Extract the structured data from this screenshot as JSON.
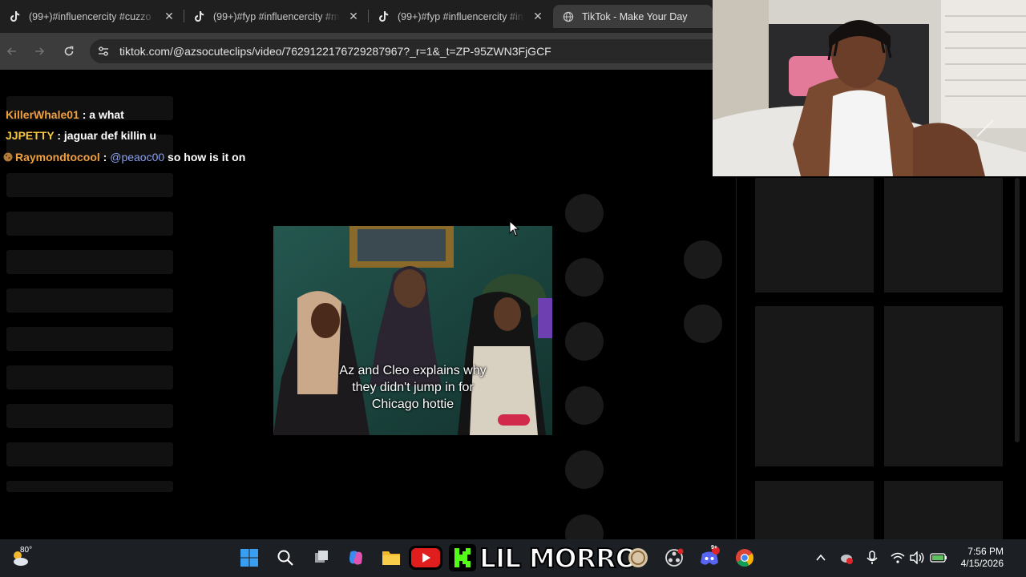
{
  "browser": {
    "tabs": [
      {
        "title": "(99+)#influencercity #cuzzo",
        "active": false
      },
      {
        "title": "(99+)#fyp #influencercity #m",
        "active": false
      },
      {
        "title": "(99+)#fyp #influencercity #inf",
        "active": false
      },
      {
        "title": "TikTok - Make Your Day",
        "active": true
      }
    ],
    "url": "tiktok.com/@azsocuteclips/video/7629122176729287967?_r=1&_t=ZP-95ZWN3FjGCF"
  },
  "chat": {
    "messages": [
      {
        "user": "KillerWhale01",
        "sep": " : ",
        "text": "a what",
        "color": "#f0a040"
      },
      {
        "user": "JJPETTY",
        "sep": " : ",
        "text": "jaguar def killin u",
        "color": "#f6c640"
      },
      {
        "user": "Raymondtocool",
        "sep": " : ",
        "mention": "@peaoc00",
        "text": " so how is it on",
        "color": "#f0a040"
      }
    ]
  },
  "video": {
    "caption_lines": [
      "Az and Cleo explains why",
      "they didn't jump in for",
      "Chicago hottie"
    ]
  },
  "taskbar": {
    "temperature": "80°",
    "overlay_text": "LIL MORRO",
    "discord_badge": "9+",
    "time": "7:56 PM",
    "date": "4/15/2026"
  }
}
